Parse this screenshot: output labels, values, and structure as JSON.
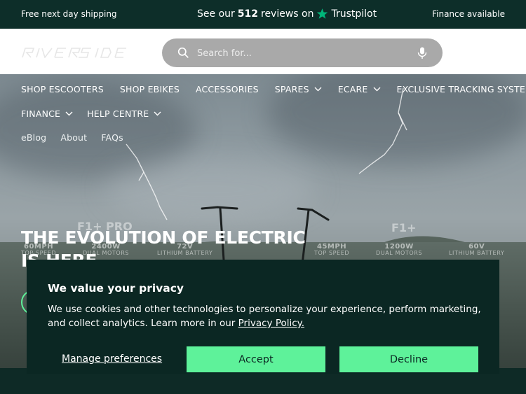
{
  "topbar": {
    "left": "Free next day shipping",
    "center_prefix": "See our",
    "review_count": "512",
    "center_middle": "reviews on",
    "trustpilot": "Trustpilot",
    "right": "Finance available"
  },
  "header": {
    "logo_text": "RIVERSIDE",
    "search_placeholder": "Search for..."
  },
  "nav": {
    "row1": [
      {
        "label": "SHOP ESCOOTERS",
        "dropdown": false
      },
      {
        "label": "SHOP EBIKES",
        "dropdown": false
      },
      {
        "label": "ACCESSORIES",
        "dropdown": false
      },
      {
        "label": "SPARES",
        "dropdown": true
      },
      {
        "label": "ECARE",
        "dropdown": true
      },
      {
        "label": "EXCLUSIVE TRACKING SYSTEM",
        "dropdown": false
      }
    ],
    "row2": [
      {
        "label": "FINANCE",
        "dropdown": true
      },
      {
        "label": "HELP CENTRE",
        "dropdown": true
      }
    ],
    "row3": [
      {
        "label": "eBlog"
      },
      {
        "label": "About"
      },
      {
        "label": "FAQs"
      }
    ]
  },
  "hero": {
    "headline": "THE EVOLUTION OF ELECTRIC IS HERE",
    "model_left": "F1+ PRO",
    "model_right": "F1+",
    "specs_left": [
      {
        "big": "60MPH",
        "small": "TOP SPEED"
      },
      {
        "big": "2400W",
        "small": "DUAL MOTORS"
      },
      {
        "big": "72V",
        "small": "LITHIUM BATTERY"
      }
    ],
    "specs_right": [
      {
        "big": "45MPH",
        "small": "TOP SPEED"
      },
      {
        "big": "1200W",
        "small": "DUAL MOTORS"
      },
      {
        "big": "60V",
        "small": "LITHIUM BATTERY"
      }
    ]
  },
  "cookie": {
    "title": "We value your privacy",
    "text": "We use cookies and other technologies to personalize your experience, perform marketing, and collect analytics. Learn more in our",
    "link": "Privacy Policy.",
    "manage": "Manage preferences",
    "accept": "Accept",
    "decline": "Decline"
  },
  "colors": {
    "dark_green": "#0d2e29",
    "accent_green": "#5ef29a",
    "trustpilot_green": "#00b67a"
  }
}
